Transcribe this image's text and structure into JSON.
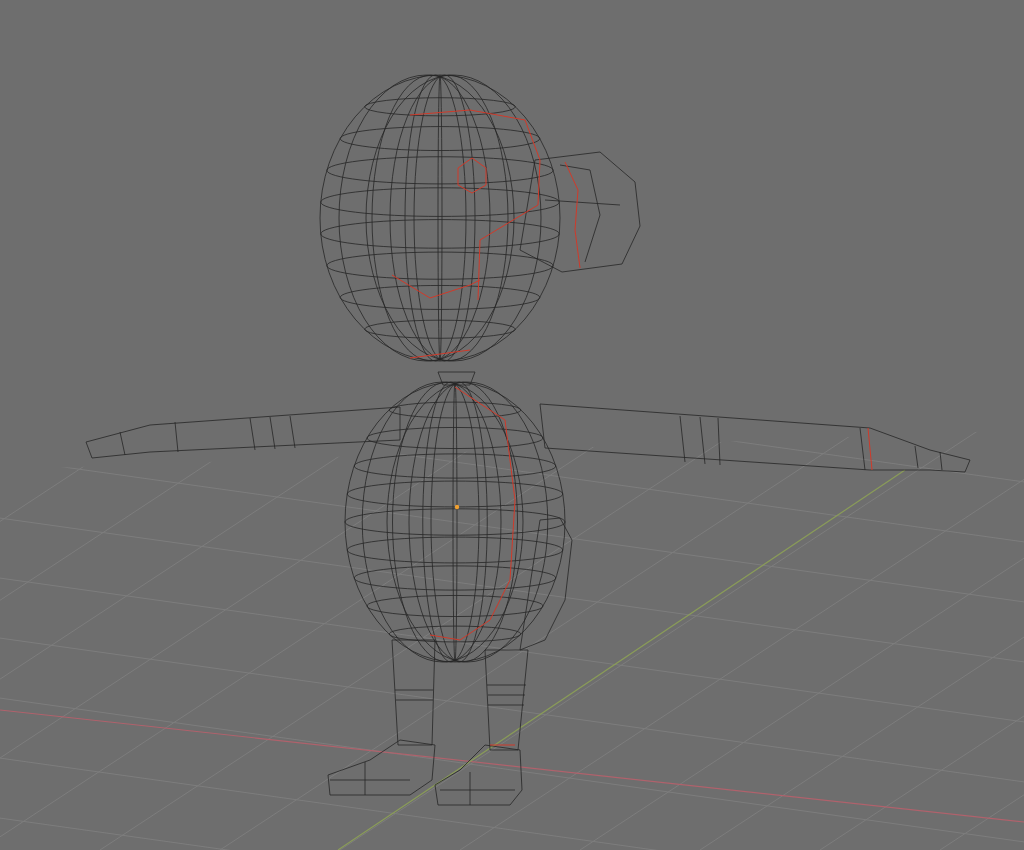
{
  "viewport": {
    "floor_grid": true,
    "x_axis": true,
    "y_axis": true,
    "origin_point": true,
    "seams": true
  }
}
